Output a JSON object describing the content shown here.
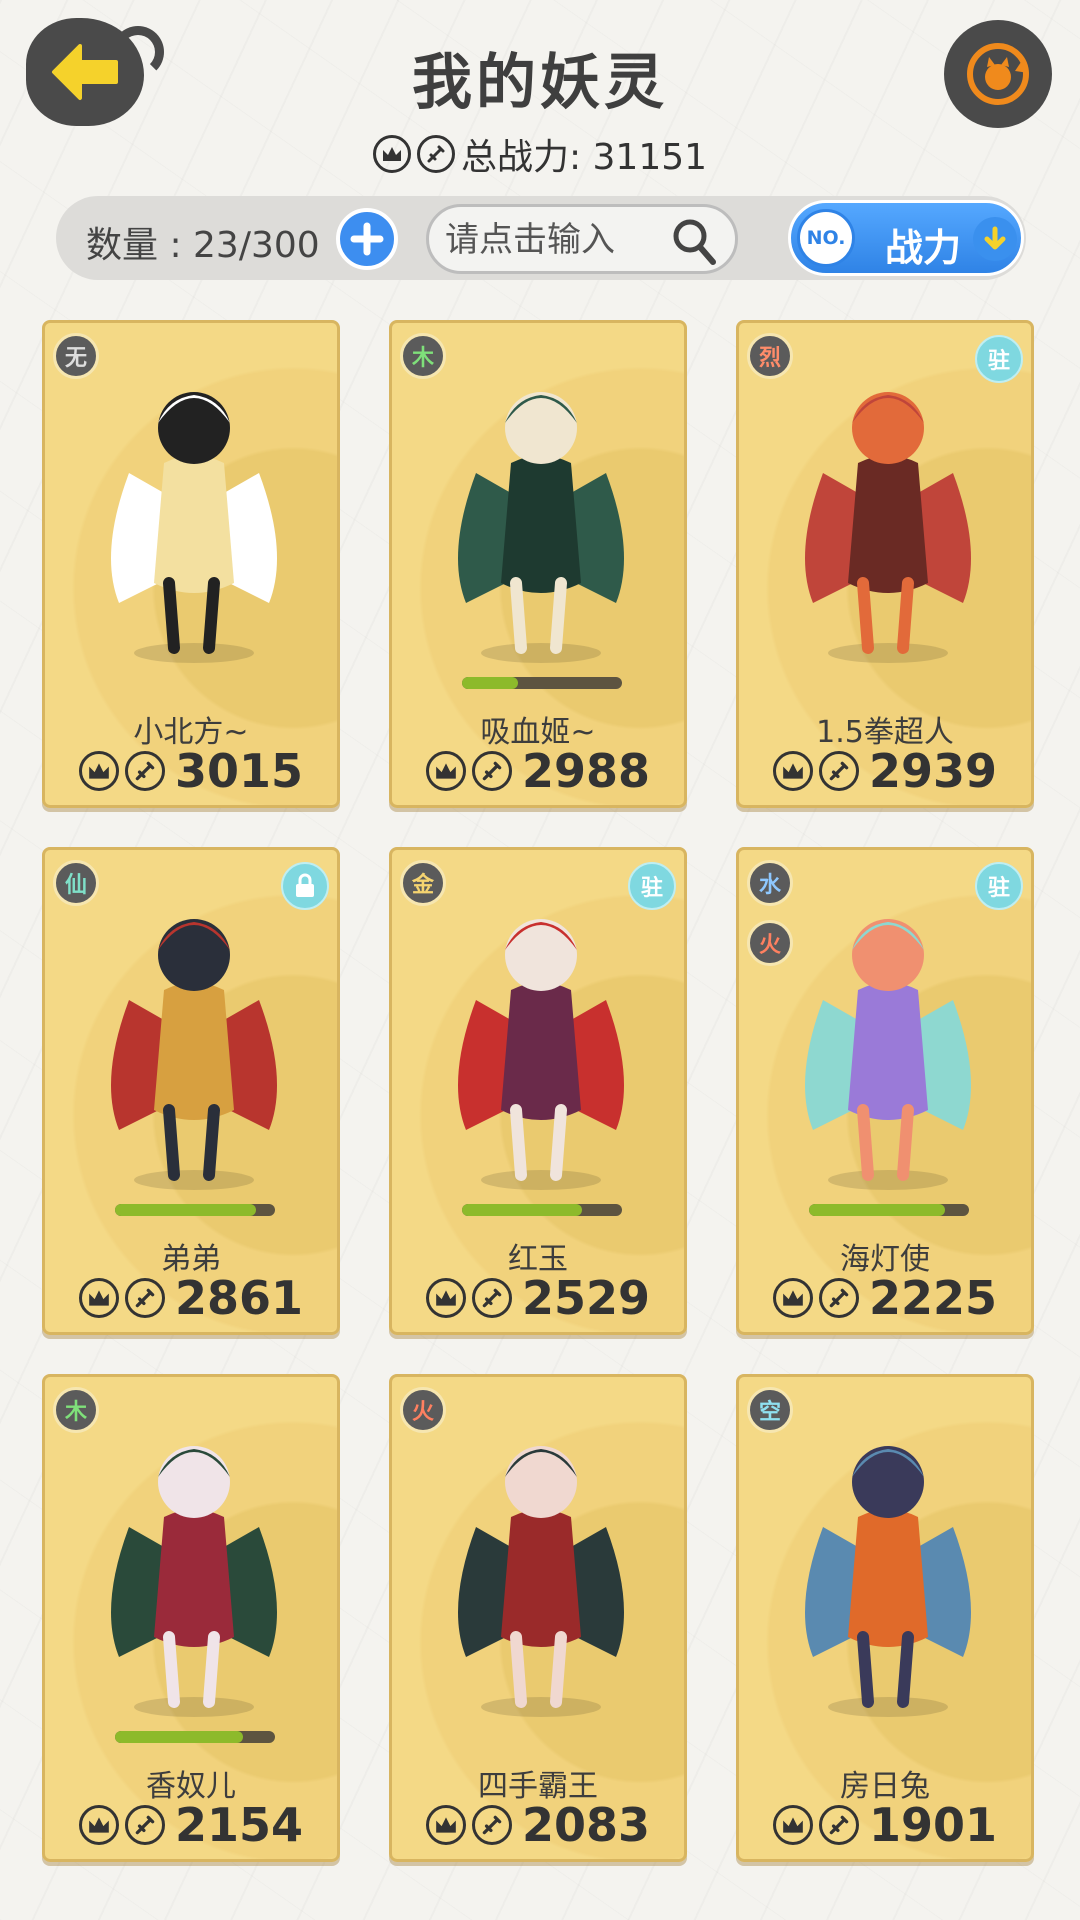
{
  "header": {
    "title": "我的妖灵",
    "total_power_label": "总战力: 31151"
  },
  "toolbar": {
    "count_label": "数量 : 23/300",
    "search_placeholder": "请点击输入",
    "sort_badge": "NO.",
    "sort_label": "战力"
  },
  "icons": {
    "back": "back-arrow-icon",
    "refresh": "swap-character-icon",
    "crown": "crown-icon",
    "sword": "sword-icon",
    "add": "plus-icon",
    "search": "search-icon",
    "sort": "down-arrow-icon",
    "lock": "lock-icon"
  },
  "colors": {
    "accent_yellow": "#f5d22b",
    "refresh_orange": "#f08a1c",
    "blue": "#3d8ef0",
    "bar_green": "#8dba2b",
    "card_gold": "#f1d27c"
  },
  "cards": [
    {
      "name": "小北方~",
      "power": "3015",
      "elements": [
        "无"
      ],
      "tag": "",
      "bar": null
    },
    {
      "name": "吸血姬~",
      "power": "2988",
      "elements": [
        "木"
      ],
      "tag": "",
      "bar": 0.35
    },
    {
      "name": "1.5拳超人",
      "power": "2939",
      "elements": [
        "烈"
      ],
      "tag": "驻",
      "bar": null
    },
    {
      "name": "弟弟",
      "power": "2861",
      "elements": [
        "仙"
      ],
      "tag": "lock",
      "bar": 0.88
    },
    {
      "name": "红玉",
      "power": "2529",
      "elements": [
        "金"
      ],
      "tag": "驻",
      "bar": 0.75
    },
    {
      "name": "海灯使",
      "power": "2225",
      "elements": [
        "水",
        "火"
      ],
      "tag": "驻",
      "bar": 0.85
    },
    {
      "name": "香奴儿",
      "power": "2154",
      "elements": [
        "木"
      ],
      "tag": "",
      "bar": 0.8
    },
    {
      "name": "四手霸王",
      "power": "2083",
      "elements": [
        "火"
      ],
      "tag": "",
      "bar": null
    },
    {
      "name": "房日兔",
      "power": "1901",
      "elements": [
        "空"
      ],
      "tag": "",
      "bar": null
    }
  ]
}
